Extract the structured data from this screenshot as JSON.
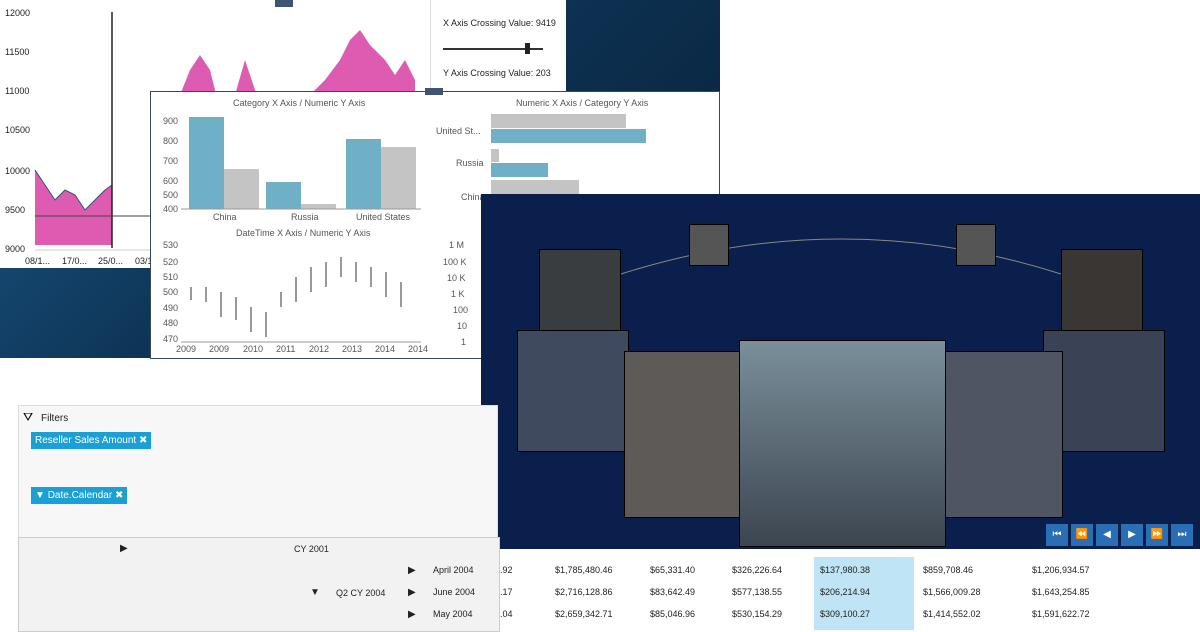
{
  "chart_top": {
    "y_ticks": [
      "12000",
      "11500",
      "11000",
      "10500",
      "10000",
      "9500",
      "9000"
    ],
    "x_ticks": [
      "08/1...",
      "17/0...",
      "25/0...",
      "03/1"
    ],
    "x_crossing_label": "X Axis Crossing Value:",
    "x_crossing_value": "9419",
    "y_crossing_label": "Y Axis Crossing Value:",
    "y_crossing_value": "203"
  },
  "chart_mid": {
    "cat_title": "Category X Axis / Numeric Y Axis",
    "cat_y_ticks": [
      "900",
      "800",
      "700",
      "600",
      "500",
      "400"
    ],
    "cat_x": [
      "China",
      "Russia",
      "United States"
    ],
    "num_cat_title": "Numeric X Axis / Category Y Axis",
    "num_cat_y": [
      "United St...",
      "Russia",
      "China"
    ],
    "dt_title": "DateTime X Axis / Numeric Y Axis",
    "dt_y_ticks": [
      "530",
      "520",
      "510",
      "500",
      "490",
      "480",
      "470"
    ],
    "dt_x_ticks": [
      "2009",
      "2009",
      "2010",
      "2011",
      "2012",
      "2013",
      "2014",
      "2014"
    ],
    "log_ticks": [
      "1 M",
      "100 K",
      "10 K",
      "1 K",
      "100",
      "10",
      "1"
    ]
  },
  "filters": {
    "title": "Filters",
    "chip1": "Reseller Sales Amount",
    "chip2": "Date.Calendar"
  },
  "pivot": {
    "cy": "CY 2001",
    "q2": "Q2 CY 2004",
    "rows": [
      {
        "month": "April 2004",
        "a": ".92",
        "b": "$1,785,480.46",
        "c": "$65,331.40",
        "d": "$326,226.64",
        "e": "$137,980.38",
        "f": "$859,708.46",
        "g": "$1,206,934.57"
      },
      {
        "month": "June 2004",
        "a": ".17",
        "b": "$2,716,128.86",
        "c": "$83,642.49",
        "d": "$577,138.55",
        "e": "$206,214.94",
        "f": "$1,566,009.28",
        "g": "$1,643,254.85"
      },
      {
        "month": "May 2004",
        "a": ".04",
        "b": "$2,659,342.71",
        "c": "$85,046.96",
        "d": "$530,154.29",
        "e": "$309,100.27",
        "f": "$1,414,552.02",
        "g": "$1,591,622.72"
      }
    ]
  },
  "nav": [
    "⏮",
    "⏪",
    "◀",
    "▶",
    "⏩",
    "⏭"
  ]
}
